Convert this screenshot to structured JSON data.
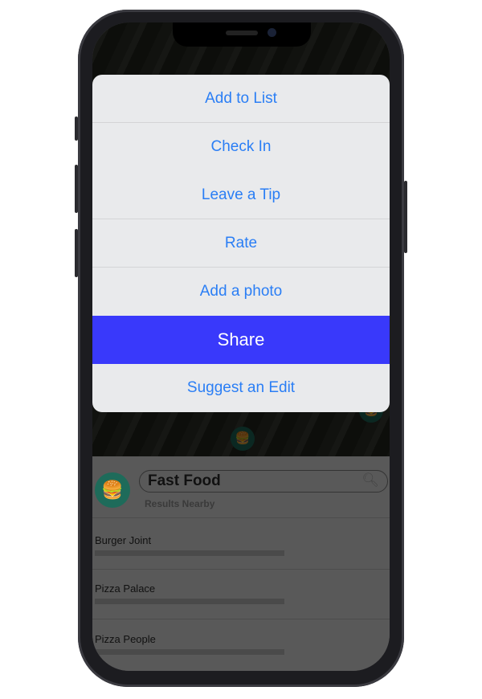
{
  "action_sheet": {
    "items": [
      {
        "label": "Add to List"
      },
      {
        "label": "Check In"
      },
      {
        "label": "Leave a Tip"
      },
      {
        "label": "Rate"
      },
      {
        "label": "Add a photo"
      },
      {
        "label": "Share",
        "selected": true
      },
      {
        "label": "Suggest an Edit"
      }
    ],
    "highlight_color": "#3939fb",
    "text_color": "#2a7ef5"
  },
  "search": {
    "value": "Fast Food",
    "icon": "magnifier-icon",
    "subtitle": "Results Nearby"
  },
  "category_icon": "burger-icon",
  "results": [
    {
      "name": "Burger Joint"
    },
    {
      "name": "Pizza Palace"
    },
    {
      "name": "Pizza People"
    }
  ]
}
